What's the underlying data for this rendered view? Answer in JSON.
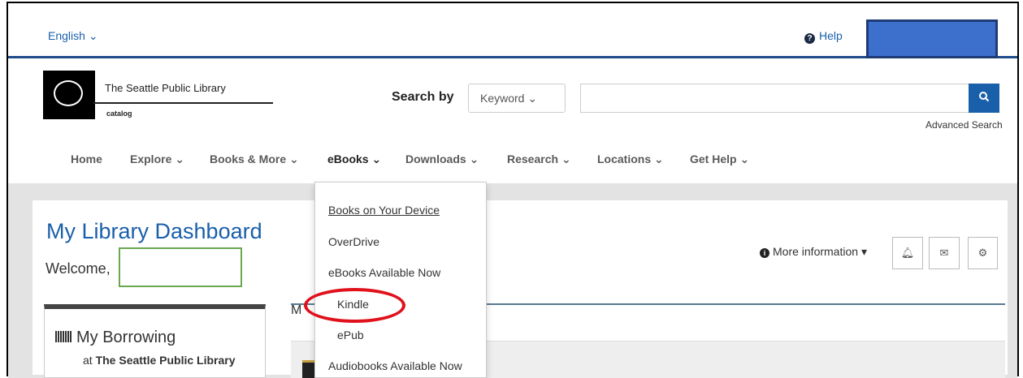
{
  "topbar": {
    "language": "English",
    "help": "Help"
  },
  "header": {
    "library_name": "The Seattle Public Library",
    "library_sub": "catalog",
    "search_by_label": "Search by",
    "search_type": "Keyword",
    "search_value": "",
    "advanced_search": "Advanced Search"
  },
  "nav": {
    "items": [
      "Home",
      "Explore",
      "Books & More",
      "eBooks",
      "Downloads",
      "Research",
      "Locations",
      "Get Help"
    ]
  },
  "dropdown": {
    "items": [
      "Books on Your Device",
      "OverDrive",
      "eBooks Available Now",
      "Kindle",
      "ePub",
      "Audiobooks Available Now"
    ]
  },
  "dashboard": {
    "title": "My Library Dashboard",
    "welcome": "Welcome,",
    "more_info": "More information",
    "borrowing_title": "My Borrowing",
    "borrowing_at_prefix": "at ",
    "borrowing_at_library": "The Seattle Public Library",
    "panel_letter": "M"
  },
  "colors": {
    "brand_blue": "#1a5faa",
    "highlight_red": "#e0111b",
    "highlight_green": "#6aa84f"
  }
}
